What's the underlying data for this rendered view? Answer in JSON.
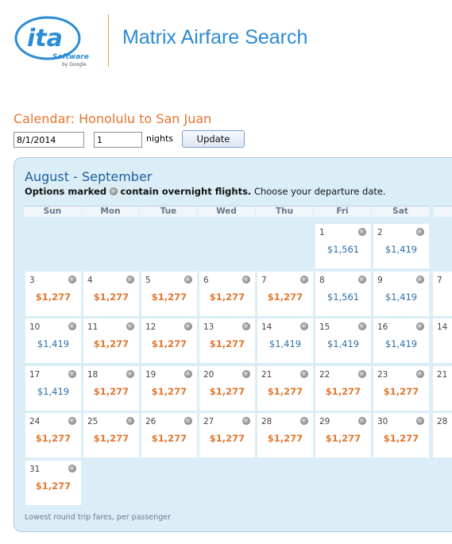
{
  "header": {
    "logo_text": "ita",
    "logo_sub": "Software",
    "logo_by": "by Google",
    "app_title": "Matrix Airfare Search"
  },
  "search": {
    "calendar_title": "Calendar: Honolulu to San Juan",
    "date_value": "8/1/2014",
    "nights_value": "1",
    "nights_label": "nights",
    "update_label": "Update"
  },
  "calendar": {
    "month_range": "August - September",
    "legend_prefix": "Options marked",
    "legend_bold": "contain overnight flights.",
    "legend_suffix": " Choose your departure date.",
    "weekdays": [
      "Sun",
      "Mon",
      "Tue",
      "Wed",
      "Thu",
      "Fri",
      "Sat"
    ],
    "weeks": [
      [
        null,
        null,
        null,
        null,
        null,
        {
          "day": "1",
          "price": "$1,561",
          "type": "blue"
        },
        {
          "day": "2",
          "price": "$1,419",
          "type": "blue"
        }
      ],
      [
        {
          "day": "3",
          "price": "$1,277",
          "type": "orange"
        },
        {
          "day": "4",
          "price": "$1,277",
          "type": "orange"
        },
        {
          "day": "5",
          "price": "$1,277",
          "type": "orange"
        },
        {
          "day": "6",
          "price": "$1,277",
          "type": "orange"
        },
        {
          "day": "7",
          "price": "$1,277",
          "type": "orange"
        },
        {
          "day": "8",
          "price": "$1,561",
          "type": "blue"
        },
        {
          "day": "9",
          "price": "$1,419",
          "type": "blue"
        }
      ],
      [
        {
          "day": "10",
          "price": "$1,419",
          "type": "blue"
        },
        {
          "day": "11",
          "price": "$1,277",
          "type": "orange"
        },
        {
          "day": "12",
          "price": "$1,277",
          "type": "orange"
        },
        {
          "day": "13",
          "price": "$1,277",
          "type": "orange"
        },
        {
          "day": "14",
          "price": "$1,419",
          "type": "blue"
        },
        {
          "day": "15",
          "price": "$1,419",
          "type": "blue"
        },
        {
          "day": "16",
          "price": "$1,419",
          "type": "blue"
        }
      ],
      [
        {
          "day": "17",
          "price": "$1,419",
          "type": "blue"
        },
        {
          "day": "18",
          "price": "$1,277",
          "type": "orange"
        },
        {
          "day": "19",
          "price": "$1,277",
          "type": "orange"
        },
        {
          "day": "20",
          "price": "$1,277",
          "type": "orange"
        },
        {
          "day": "21",
          "price": "$1,277",
          "type": "orange"
        },
        {
          "day": "22",
          "price": "$1,277",
          "type": "orange"
        },
        {
          "day": "23",
          "price": "$1,277",
          "type": "orange"
        }
      ],
      [
        {
          "day": "24",
          "price": "$1,277",
          "type": "orange"
        },
        {
          "day": "25",
          "price": "$1,277",
          "type": "orange"
        },
        {
          "day": "26",
          "price": "$1,277",
          "type": "orange"
        },
        {
          "day": "27",
          "price": "$1,277",
          "type": "orange"
        },
        {
          "day": "28",
          "price": "$1,277",
          "type": "orange"
        },
        {
          "day": "29",
          "price": "$1,277",
          "type": "orange"
        },
        {
          "day": "30",
          "price": "$1,277",
          "type": "orange"
        }
      ],
      [
        {
          "day": "31",
          "price": "$1,277",
          "type": "orange"
        },
        null,
        null,
        null,
        null,
        null,
        null
      ]
    ],
    "next_month_days": [
      "7",
      "14",
      "21",
      "28"
    ],
    "footnote": "Lowest round trip fares, per passenger"
  },
  "colors": {
    "brand_orange": "#e2762f",
    "brand_blue": "#2a8bd6",
    "panel_bg": "#dbeef8",
    "price_blue": "#2f6fa8"
  },
  "icons": {
    "overnight": "moon-icon"
  }
}
